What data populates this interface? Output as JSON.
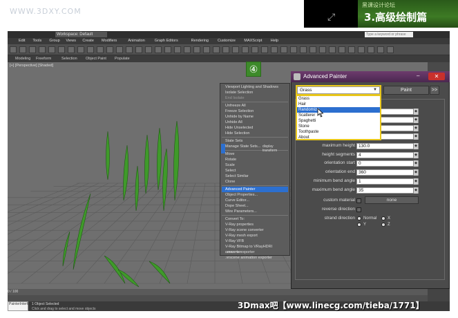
{
  "watermark": {
    "site": "WWW.3DXY.COM",
    "tutorial_top": "黑课设计论坛",
    "tutorial_title": "3.高级绘制篇",
    "brand": "3Dmax吧【www.linecg.com/tieba/1771】"
  },
  "app": {
    "workspace": "Workspace: Default",
    "search_placeholder": "Type a keyword or phrase",
    "menus": [
      "Edit",
      "Tools",
      "Group",
      "Views",
      "Create",
      "Modifiers",
      "Animation",
      "Graph Editors",
      "Rendering",
      "Customize",
      "MAXScript",
      "Help"
    ],
    "ribbon_tabs": [
      "Modeling",
      "Freeform",
      "Selection",
      "Object Paint",
      "Populate"
    ],
    "viewport_label": "[+] [Perspective] [Shaded]",
    "step_badge": "④",
    "timeline": "0 / 100",
    "maxscript": "PainterInterfac",
    "status_line1": "1 Object Selected",
    "status_line2": "Click and drag to select and move objects"
  },
  "quad_menu": {
    "items": [
      {
        "label": "Viewport Lighting and Shadows",
        "state": "normal"
      },
      {
        "label": "Isolate Selection",
        "state": "normal"
      },
      {
        "label": "End Isolate",
        "state": "dim"
      },
      {
        "label": "Unfreeze All",
        "state": "normal"
      },
      {
        "label": "Freeze Selection",
        "state": "normal"
      },
      {
        "label": "Unhide by Name",
        "state": "normal"
      },
      {
        "label": "Unhide All",
        "state": "normal"
      },
      {
        "label": "Hide Unselected",
        "state": "normal"
      },
      {
        "label": "Hide Selection",
        "state": "normal"
      },
      {
        "label": "State Sets",
        "state": "normal"
      },
      {
        "label": "Manage State Sets...",
        "state": "normal"
      },
      {
        "label": "Move",
        "state": "normal"
      },
      {
        "label": "Rotate",
        "state": "normal"
      },
      {
        "label": "Scale",
        "state": "normal"
      },
      {
        "label": "Select",
        "state": "normal"
      },
      {
        "label": "Select Similar",
        "state": "normal"
      },
      {
        "label": "Clone",
        "state": "normal"
      },
      {
        "label": "Advanced Painter",
        "state": "selected"
      },
      {
        "label": "Object Properties...",
        "state": "normal"
      },
      {
        "label": "Curve Editor...",
        "state": "normal"
      },
      {
        "label": "Dope Sheet...",
        "state": "normal"
      },
      {
        "label": "Wire Parameters...",
        "state": "normal"
      },
      {
        "label": "Convert To:",
        "state": "normal"
      },
      {
        "label": "V-Ray properties",
        "state": "normal"
      },
      {
        "label": "V-Ray scene converter",
        "state": "normal"
      },
      {
        "label": "V-Ray mesh export",
        "state": "normal"
      },
      {
        "label": "V-Ray VFB",
        "state": "normal"
      },
      {
        "label": "V-Ray Bitmap to VRayHDRI converter",
        "state": "normal"
      },
      {
        "label": ".vrscene exporter",
        "state": "normal"
      },
      {
        "label": ".vrscene animation exporter",
        "state": "normal"
      }
    ],
    "side_display": "display",
    "side_transform": "transform"
  },
  "advanced_painter": {
    "title": "Advanced Painter",
    "selected_brush": "Grass",
    "paint_label": "Paint",
    "more_label": ">>",
    "brush_options": [
      "Grass",
      "Hair",
      "Randomize",
      "Scatterer",
      "Spaghetti",
      "Stone",
      "Toothpaste",
      "About"
    ],
    "highlighted_option": "Randomize",
    "params": [
      {
        "label": "maximum height",
        "value": "130.0"
      },
      {
        "label": "height segments",
        "value": "4"
      },
      {
        "label": "orientation start",
        "value": "0"
      },
      {
        "label": "orientation end",
        "value": "360"
      },
      {
        "label": "minimum bend angle",
        "value": "1"
      },
      {
        "label": "maximum bend angle",
        "value": "35"
      }
    ],
    "custom_material_label": "custom material",
    "material_value": "none",
    "reverse_direction_label": "reverse direction",
    "strand_direction_label": "strand direction",
    "strand_options": [
      "Normal",
      "X",
      "Y",
      "Z"
    ]
  }
}
